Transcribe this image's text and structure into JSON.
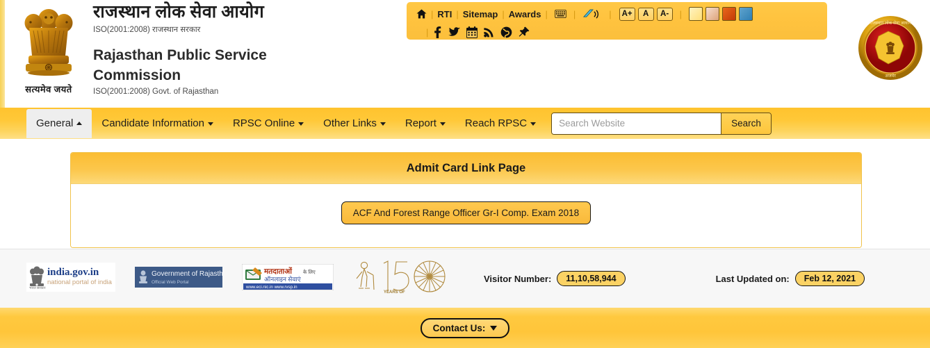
{
  "header": {
    "hindi_title": "राजस्थान लोक सेवा आयोग",
    "hindi_sub": "ISO(2001:2008) राजस्थान सरकार",
    "english_title": "Rajasthan Public Service Commission",
    "english_sub": "ISO(2001:2008) Govt. of Rajasthan",
    "emblem_caption": "सत्यमेव जयते",
    "emblem_icon": "ashoka-lion-capital-emblem",
    "seal_icon": "rpsc-circular-seal"
  },
  "topbar": {
    "home_icon": "home-icon",
    "links": [
      {
        "label": "RTI"
      },
      {
        "label": "Sitemap"
      },
      {
        "label": "Awards"
      }
    ],
    "keyboard_icon": "keyboard-icon",
    "screenreader_icon": "screen-reader-icon",
    "font_buttons": [
      {
        "label": "A+",
        "name": "font-increase-button"
      },
      {
        "label": "A",
        "name": "font-normal-button"
      },
      {
        "label": "A-",
        "name": "font-decrease-button"
      }
    ],
    "theme_swatches": [
      {
        "name": "theme-swatch-yellow",
        "color": "#ffe28a"
      },
      {
        "name": "theme-swatch-peach",
        "color": "#e8b68e"
      },
      {
        "name": "theme-swatch-orange",
        "color": "#d8450c"
      },
      {
        "name": "theme-swatch-blue",
        "color": "#3d8ec0"
      }
    ],
    "social_icons": [
      {
        "name": "facebook-icon"
      },
      {
        "name": "twitter-icon"
      },
      {
        "name": "calendar-icon"
      },
      {
        "name": "rss-icon"
      },
      {
        "name": "globe-icon"
      },
      {
        "name": "pin-icon"
      }
    ]
  },
  "nav": {
    "items": [
      {
        "label": "General",
        "active": true,
        "caret": "up"
      },
      {
        "label": "Candidate Information",
        "active": false,
        "caret": "down"
      },
      {
        "label": "RPSC Online",
        "active": false,
        "caret": "down"
      },
      {
        "label": "Other Links",
        "active": false,
        "caret": "down"
      },
      {
        "label": "Report",
        "active": false,
        "caret": "down"
      },
      {
        "label": "Reach RPSC",
        "active": false,
        "caret": "down"
      }
    ],
    "search_placeholder": "Search Website",
    "search_value": "",
    "search_button": "Search"
  },
  "main": {
    "panel_title": "Admit Card Link Page",
    "links": [
      {
        "label": "ACF And Forest Range Officer Gr-I Comp. Exam 2018"
      }
    ]
  },
  "footer": {
    "logos": [
      {
        "name": "india-gov-in-logo",
        "line1": "india.gov.in",
        "line2": "national portal of india"
      },
      {
        "name": "government-of-rajasthan-logo",
        "line1": "Government of Rajasthan",
        "line2": "Official Web Portal"
      },
      {
        "name": "voter-services-logo",
        "line1": "मतदाताओं के लिए",
        "line2": "ऑनलाइन सेवाएं"
      },
      {
        "name": "mahatma-gandhi-150-logo",
        "line1": "150",
        "line2": "YEARS OF CELEBRATING THE MAHATMA"
      }
    ],
    "visitor_label": "Visitor Number:",
    "visitor_count": "11,10,58,944",
    "updated_label": "Last Updated on:",
    "updated_date": "Feb 12, 2021"
  },
  "bottombar": {
    "contact_label": "Contact Us:",
    "contact_icon": "chevron-down-icon"
  },
  "colors": {
    "brand_gold": "#ffc53a",
    "panel_border": "#f0c24a",
    "pill_bg": "#fbd264"
  }
}
